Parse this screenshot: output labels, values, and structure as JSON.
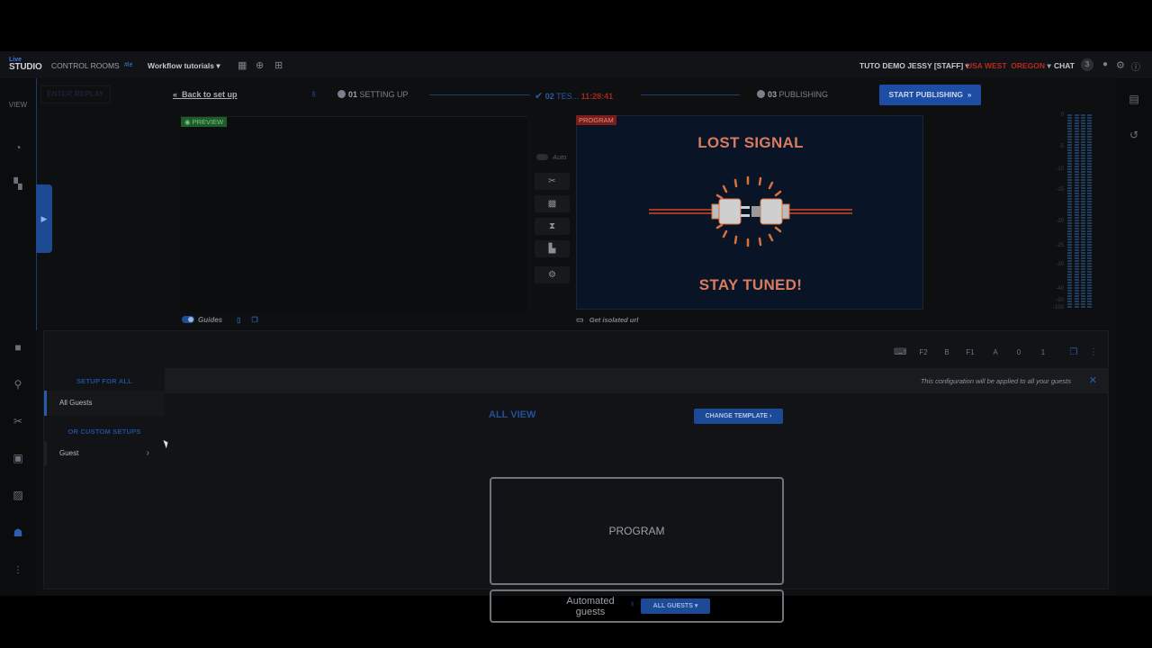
{
  "app": {
    "logo_line1": "Live",
    "logo_line2": "STUDIO"
  },
  "topbar": {
    "control_rooms": "CONTROL ROOMS",
    "room_badge": "#le",
    "workflow": "Workflow tutorials",
    "account": "TUTO DEMO JESSY [STAFF]",
    "region": "USA WEST",
    "zone": "OREGON",
    "chat_label": "CHAT",
    "chat_count": "3"
  },
  "leftnav": {
    "view_label": "VIEW"
  },
  "steps": {
    "enter_replay": "ENTER REPLAY",
    "back_link": "Back to set up",
    "step1_num": "01",
    "step1_label": "SETTING UP",
    "step2_num": "02",
    "step2_label": "TES...",
    "step2_timer": "11:28:41",
    "step3_num": "03",
    "step3_label": "PUBLISHING",
    "start_publishing": "START PUBLISHING"
  },
  "preview": {
    "tag": "PREVIEW",
    "guides_label": "Guides"
  },
  "controls": {
    "auto_label": "Auto"
  },
  "program": {
    "tag": "PROGRAM",
    "lost_signal": "LOST SIGNAL",
    "stay_tuned": "STAY TUNED!",
    "isolated_url": "Get isolated url"
  },
  "vu_scale": [
    "0",
    "-5",
    "-10",
    "-15",
    "-20",
    "-25",
    "-30",
    "-40",
    "-50",
    "-100"
  ],
  "lower_toolbar": [
    "F2",
    "B",
    "F1",
    "A",
    "0",
    "1"
  ],
  "config": {
    "notice": "This configuration will be applied to all your guests",
    "setup_for_all": "SETUP FOR ALL",
    "all_guests": "All Guests",
    "or_custom": "OR CUSTOM SETUPS",
    "guest": "Guest",
    "all_view": "ALL VIEW",
    "change_template": "CHANGE TEMPLATE",
    "program_box": "PROGRAM",
    "automated_guests": "Automated guests",
    "all_guests_btn": "ALL GUESTS"
  },
  "colors": {
    "accent": "#1d4ea3",
    "program_red": "#7a1e1a",
    "preview_green": "#1e5d29",
    "signal_orange": "#d97b5e"
  }
}
